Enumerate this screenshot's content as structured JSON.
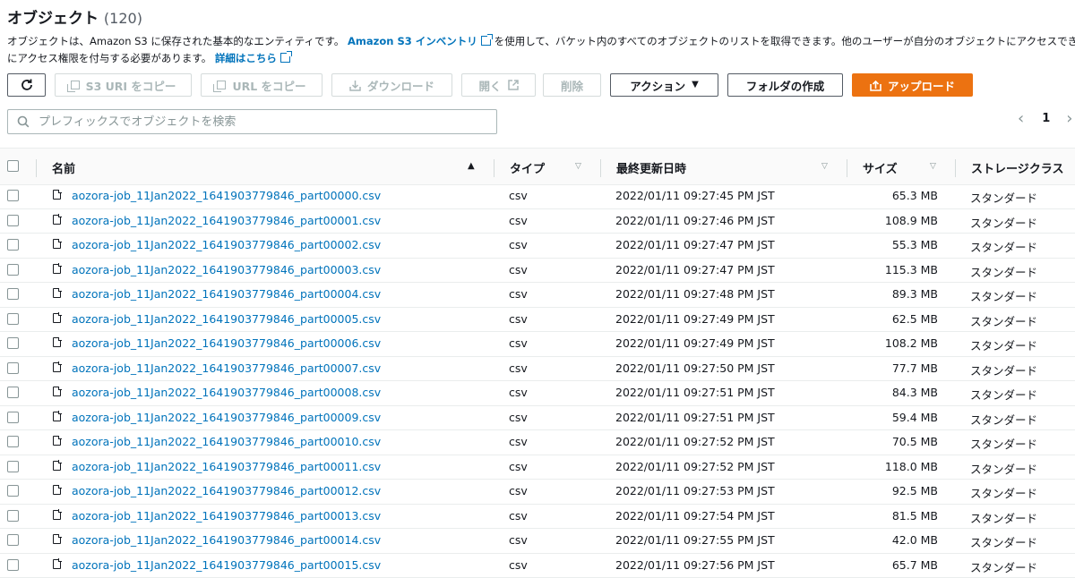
{
  "header": {
    "title": "オブジェクト",
    "count": "(120)"
  },
  "description": {
    "text1": "オブジェクトは、Amazon S3 に保存された基本的なエンティティです。",
    "link1": "Amazon S3 インベントリ",
    "text2": "を使用して、バケット内のすべてのオブジェクトのリストを取得できます。他のユーザーが自分のオブジェクトにアクセスできるためには、",
    "text3": "にアクセス権限を付与する必要があります。",
    "link2": "詳細はこちら"
  },
  "toolbar": {
    "refresh_icon": "refresh-icon",
    "copy_s3_uri": "S3 URI をコピー",
    "copy_url": "URL をコピー",
    "download": "ダウンロード",
    "open": "開く",
    "delete": "削除",
    "actions": "アクション",
    "create_folder": "フォルダの作成",
    "upload": "アップロード"
  },
  "search": {
    "placeholder": "プレフィックスでオブジェクトを検索"
  },
  "pagination": {
    "current": "1"
  },
  "table": {
    "columns": {
      "name": "名前",
      "type": "タイプ",
      "modified": "最終更新日時",
      "size": "サイズ",
      "storage": "ストレージクラス"
    },
    "rows": [
      {
        "name": "aozora-job_11Jan2022_1641903779846_part00000.csv",
        "type": "csv",
        "modified": "2022/01/11 09:27:45 PM JST",
        "size": "65.3 MB",
        "storage": "スタンダード"
      },
      {
        "name": "aozora-job_11Jan2022_1641903779846_part00001.csv",
        "type": "csv",
        "modified": "2022/01/11 09:27:46 PM JST",
        "size": "108.9 MB",
        "storage": "スタンダード"
      },
      {
        "name": "aozora-job_11Jan2022_1641903779846_part00002.csv",
        "type": "csv",
        "modified": "2022/01/11 09:27:47 PM JST",
        "size": "55.3 MB",
        "storage": "スタンダード"
      },
      {
        "name": "aozora-job_11Jan2022_1641903779846_part00003.csv",
        "type": "csv",
        "modified": "2022/01/11 09:27:47 PM JST",
        "size": "115.3 MB",
        "storage": "スタンダード"
      },
      {
        "name": "aozora-job_11Jan2022_1641903779846_part00004.csv",
        "type": "csv",
        "modified": "2022/01/11 09:27:48 PM JST",
        "size": "89.3 MB",
        "storage": "スタンダード"
      },
      {
        "name": "aozora-job_11Jan2022_1641903779846_part00005.csv",
        "type": "csv",
        "modified": "2022/01/11 09:27:49 PM JST",
        "size": "62.5 MB",
        "storage": "スタンダード"
      },
      {
        "name": "aozora-job_11Jan2022_1641903779846_part00006.csv",
        "type": "csv",
        "modified": "2022/01/11 09:27:49 PM JST",
        "size": "108.2 MB",
        "storage": "スタンダード"
      },
      {
        "name": "aozora-job_11Jan2022_1641903779846_part00007.csv",
        "type": "csv",
        "modified": "2022/01/11 09:27:50 PM JST",
        "size": "77.7 MB",
        "storage": "スタンダード"
      },
      {
        "name": "aozora-job_11Jan2022_1641903779846_part00008.csv",
        "type": "csv",
        "modified": "2022/01/11 09:27:51 PM JST",
        "size": "84.3 MB",
        "storage": "スタンダード"
      },
      {
        "name": "aozora-job_11Jan2022_1641903779846_part00009.csv",
        "type": "csv",
        "modified": "2022/01/11 09:27:51 PM JST",
        "size": "59.4 MB",
        "storage": "スタンダード"
      },
      {
        "name": "aozora-job_11Jan2022_1641903779846_part00010.csv",
        "type": "csv",
        "modified": "2022/01/11 09:27:52 PM JST",
        "size": "70.5 MB",
        "storage": "スタンダード"
      },
      {
        "name": "aozora-job_11Jan2022_1641903779846_part00011.csv",
        "type": "csv",
        "modified": "2022/01/11 09:27:52 PM JST",
        "size": "118.0 MB",
        "storage": "スタンダード"
      },
      {
        "name": "aozora-job_11Jan2022_1641903779846_part00012.csv",
        "type": "csv",
        "modified": "2022/01/11 09:27:53 PM JST",
        "size": "92.5 MB",
        "storage": "スタンダード"
      },
      {
        "name": "aozora-job_11Jan2022_1641903779846_part00013.csv",
        "type": "csv",
        "modified": "2022/01/11 09:27:54 PM JST",
        "size": "81.5 MB",
        "storage": "スタンダード"
      },
      {
        "name": "aozora-job_11Jan2022_1641903779846_part00014.csv",
        "type": "csv",
        "modified": "2022/01/11 09:27:55 PM JST",
        "size": "42.0 MB",
        "storage": "スタンダード"
      },
      {
        "name": "aozora-job_11Jan2022_1641903779846_part00015.csv",
        "type": "csv",
        "modified": "2022/01/11 09:27:56 PM JST",
        "size": "65.7 MB",
        "storage": "スタンダード"
      }
    ]
  }
}
